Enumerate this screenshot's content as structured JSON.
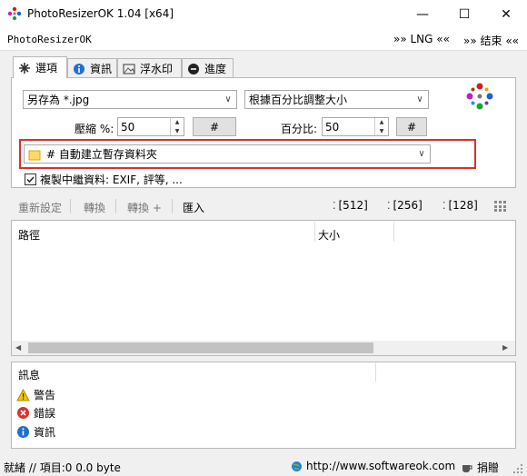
{
  "window": {
    "title": "PhotoResizerOK 1.04 [x64]",
    "minimize": "—",
    "maximize": "☐",
    "close": "✕"
  },
  "menubar": {
    "app_label": "PhotoResizerOK",
    "lng": "»» LNG ««",
    "exit": "»» 结束 ««"
  },
  "tabs": [
    {
      "label": "選項",
      "icon": "options-icon"
    },
    {
      "label": "資訊",
      "icon": "info-icon"
    },
    {
      "label": "浮水印",
      "icon": "watermark-icon"
    },
    {
      "label": "進度",
      "icon": "progress-icon"
    }
  ],
  "options": {
    "save_as": "另存為 *.jpg",
    "resize_mode": "根據百分比調整大小",
    "compress_label": "壓縮 %:",
    "compress_value": "50",
    "percent_label": "百分比:",
    "percent_value": "50",
    "hash_button": "#",
    "folder": "# 自動建立暫存資料夾",
    "copy_meta": "複製中繼資料: EXIF, 評等, ..."
  },
  "toolbar": {
    "reset": "重新設定",
    "convert": "轉換",
    "convert_plus": "轉換 +",
    "import": "匯入",
    "size512": "[512]",
    "size256": "[256]",
    "size128": "[128]"
  },
  "list": {
    "col_path": "路徑",
    "col_size": "大小"
  },
  "messages": {
    "header": "訊息",
    "warning": "警告",
    "error": "錯誤",
    "info": "資訊"
  },
  "status": {
    "text": "就緒 // 項目:0 0.0 byte",
    "url": "http://www.softwareok.com",
    "donate": "捐贈"
  },
  "colors": {
    "accent_red": "#d9302c",
    "info_blue": "#1e6fd0",
    "error_red": "#d8342c",
    "warn_yellow": "#f5c400"
  }
}
